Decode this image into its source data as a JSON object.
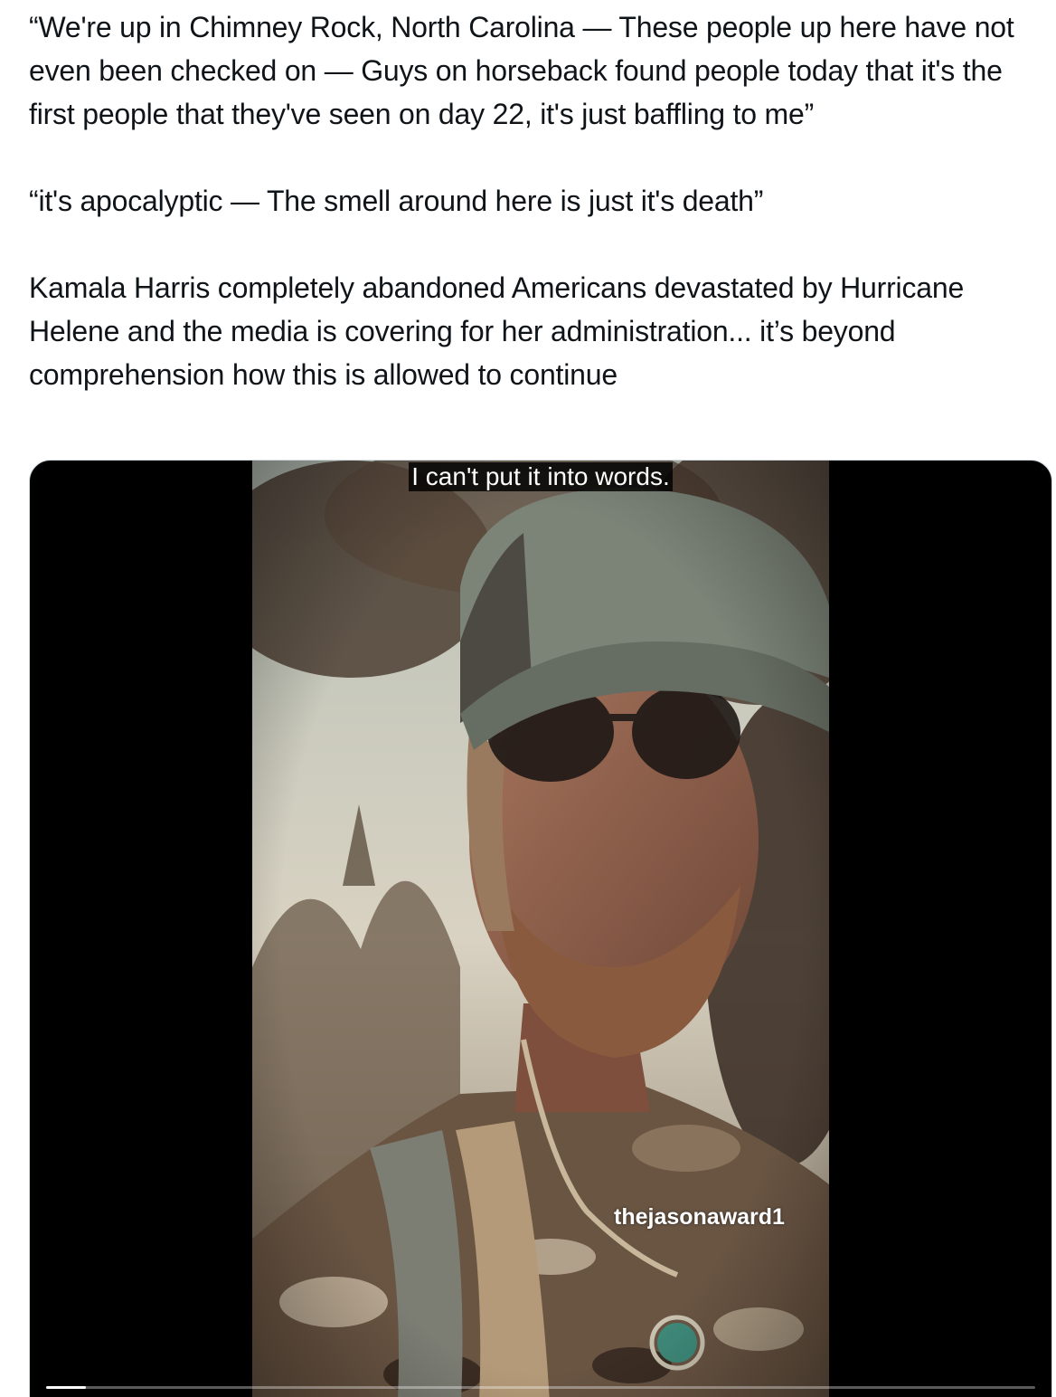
{
  "tweet": {
    "paragraphs": [
      "“We're up in Chimney Rock, North Carolina — These people up here have not even been checked on — Guys on horseback found people today that it's the first people that they've seen on day 22, it's just baffling to me”",
      "“it's apocalyptic — The smell around here is just it's death”",
      "Kamala Harris completely abandoned Americans devastated by Hurricane Helene and the media is covering for her administration... it’s beyond comprehension how this is allowed to continue"
    ]
  },
  "video": {
    "caption": "I can't put it into words.",
    "watermark": "thejasonaward1",
    "progress": 0.04
  },
  "colors": {
    "text": "#0f1419",
    "media_background": "#000000",
    "card_border": "#cfd9de"
  }
}
